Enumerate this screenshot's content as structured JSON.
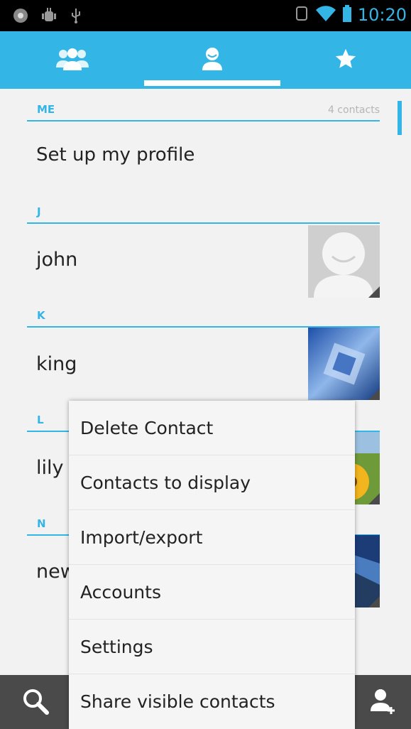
{
  "status_bar": {
    "time": "10:20",
    "left_icons": [
      "chrome-icon",
      "android-debug-icon",
      "usb-icon"
    ],
    "right_icons": [
      "sync-icon",
      "wifi-icon",
      "battery-icon"
    ]
  },
  "tabs": {
    "groups_icon": "groups-icon",
    "contacts_icon": "person-icon",
    "favorites_icon": "star-icon",
    "accent": "#33b5e5"
  },
  "contacts": {
    "me_section": {
      "letter": "ME",
      "count": "4 contacts"
    },
    "profile_row": "Set up my profile",
    "sections": [
      {
        "letter": "J",
        "name": "john"
      },
      {
        "letter": "K",
        "name": "king"
      },
      {
        "letter": "L",
        "name": "lily"
      },
      {
        "letter": "N",
        "name": "new"
      }
    ]
  },
  "menu": {
    "items": [
      "Delete Contact",
      "Contacts to display",
      "Import/export",
      "Accounts",
      "Settings",
      "Share visible contacts"
    ]
  },
  "bottom_bar": {
    "search_icon": "search-icon",
    "add_contact_icon": "add-contact-icon"
  }
}
